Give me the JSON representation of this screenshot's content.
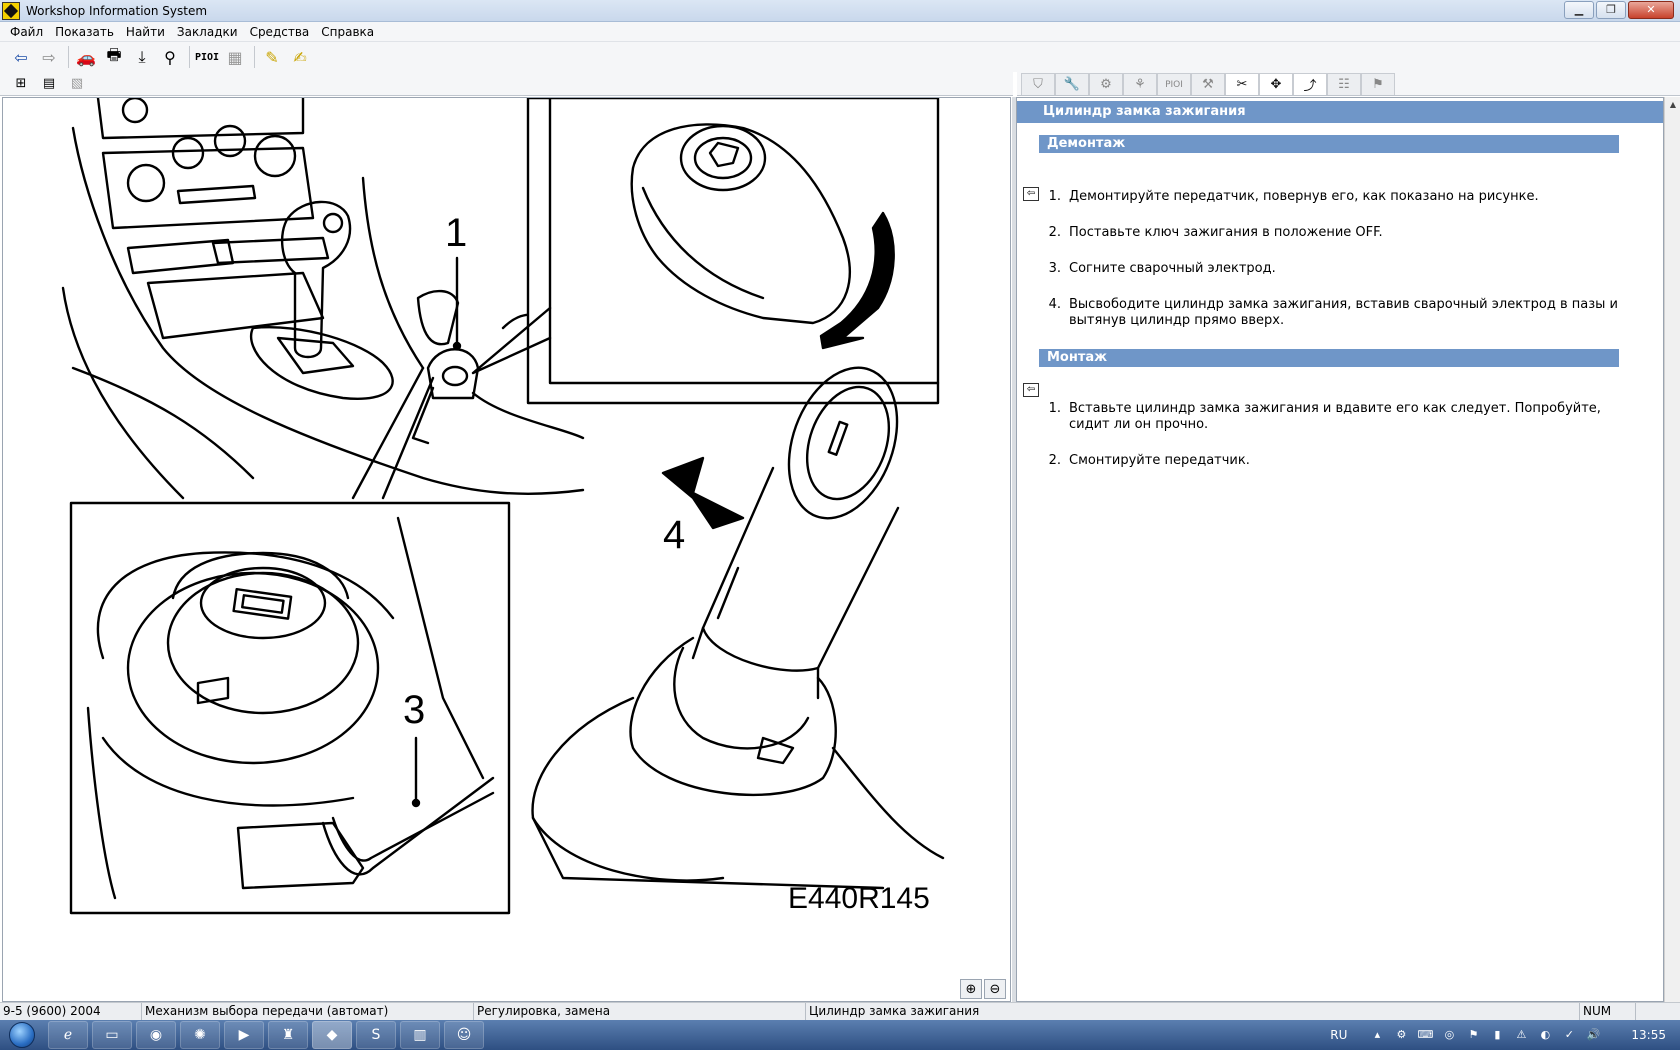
{
  "window": {
    "title": "Workshop Information System"
  },
  "menu": [
    "Файл",
    "Показать",
    "Найти",
    "Закладки",
    "Средства",
    "Справка"
  ],
  "toolbar": {
    "pin_label": "PIOI"
  },
  "right_tabs": {
    "pin_label": "PIOI"
  },
  "illustration": {
    "code": "E440R145",
    "callouts": [
      "1",
      "3",
      "4"
    ]
  },
  "document": {
    "title": "Цилиндр замка зажигания",
    "sections": [
      {
        "heading": "Демонтаж",
        "steps": [
          {
            "num": "1.",
            "text": "Демонтируйте передатчик, повернув его, как показано на рисунке."
          },
          {
            "num": "2.",
            "text": "Поставьте ключ зажигания в положение OFF."
          },
          {
            "num": "3.",
            "text": "Согните сварочный электрод."
          },
          {
            "num": "4.",
            "text": "Высвободите цилиндр замка зажигания, вставив сварочный электрод в пазы и вытянув цилиндр прямо вверх."
          }
        ]
      },
      {
        "heading": "Монтаж",
        "steps": [
          {
            "num": "1.",
            "text": "Вставьте цилиндр замка зажигания и вдавите его как следует. Попробуйте, сидит ли он прочно."
          },
          {
            "num": "2.",
            "text": "Смонтируйте передатчик."
          }
        ]
      }
    ]
  },
  "status": {
    "model": "9-5 (9600) 2004",
    "group": "Механизм выбора передачи (автомат)",
    "operation": "Регулировка, замена",
    "item": "Цилиндр замка зажигания",
    "num": "NUM"
  },
  "taskbar": {
    "lang": "RU",
    "time": "13:55"
  }
}
